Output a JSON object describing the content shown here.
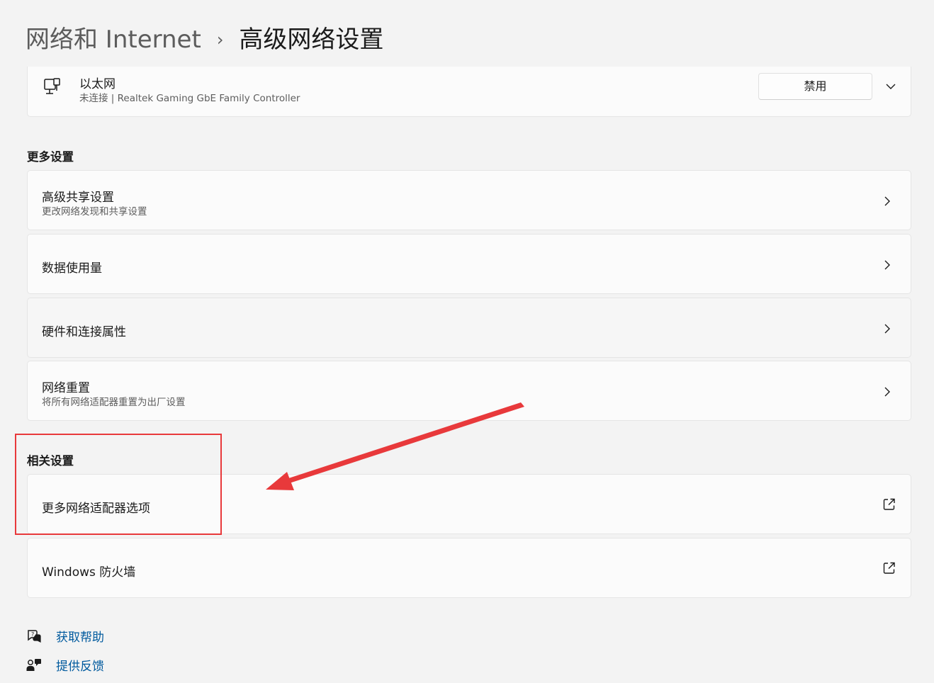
{
  "breadcrumb": {
    "parent": "网络和 Internet",
    "separator": "›",
    "current": "高级网络设置"
  },
  "ethernet": {
    "icon": "ethernet-icon",
    "title": "以太网",
    "subtitle": "未连接 | Realtek Gaming GbE Family Controller",
    "disable_label": "禁用"
  },
  "more_settings": {
    "heading": "更多设置",
    "items": [
      {
        "title": "高级共享设置",
        "subtitle": "更改网络发现和共享设置"
      },
      {
        "title": "数据使用量",
        "subtitle": ""
      },
      {
        "title": "硬件和连接属性",
        "subtitle": ""
      },
      {
        "title": "网络重置",
        "subtitle": "将所有网络适配器重置为出厂设置"
      }
    ]
  },
  "related_settings": {
    "heading": "相关设置",
    "items": [
      {
        "title": "更多网络适配器选项"
      },
      {
        "title": "Windows 防火墙"
      }
    ]
  },
  "footer": {
    "help_label": "获取帮助",
    "feedback_label": "提供反馈"
  },
  "colors": {
    "annotation": "#e8393b",
    "link": "#005a9e",
    "background": "#f3f3f3",
    "card": "#fbfbfb"
  }
}
